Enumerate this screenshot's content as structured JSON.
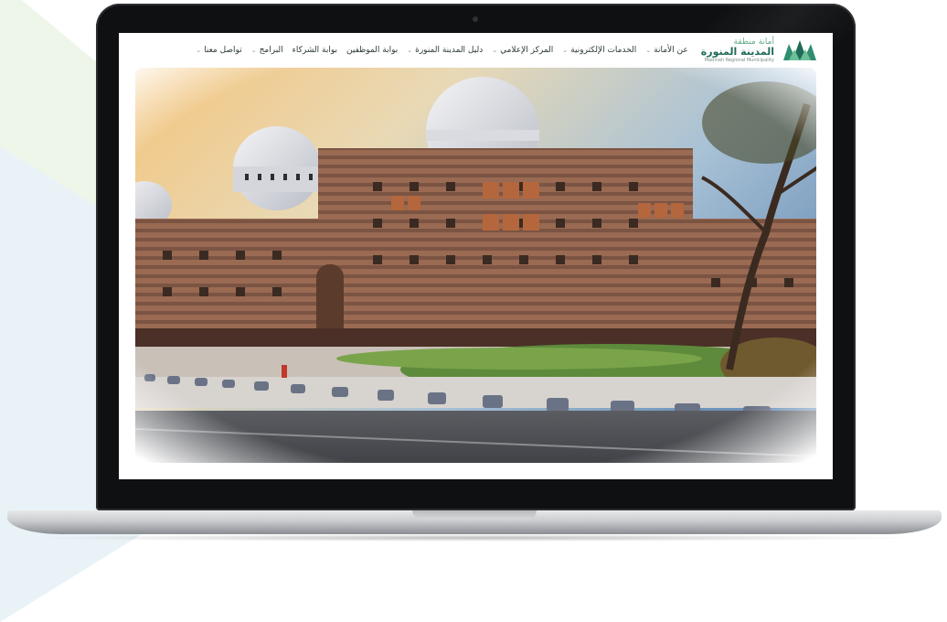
{
  "site": {
    "logo": {
      "arabic_line1": "أمانة منطقة",
      "arabic_line2": "المدينة المنورة",
      "english": "Madinah Regional Municipality"
    },
    "nav": [
      {
        "label": "عن الأمانة",
        "has_dropdown": true
      },
      {
        "label": "الخدمات الإلكترونية",
        "has_dropdown": true
      },
      {
        "label": "المركز الإعلامي",
        "has_dropdown": true
      },
      {
        "label": "دليل المدينة المنورة",
        "has_dropdown": true
      },
      {
        "label": "بوابة الموظفين",
        "has_dropdown": false
      },
      {
        "label": "بوابة الشركاء",
        "has_dropdown": false
      },
      {
        "label": "البرامج",
        "has_dropdown": true
      },
      {
        "label": "تواصل معنا",
        "has_dropdown": true
      }
    ],
    "hero": {
      "image_description": "Municipality building with domes at sunset"
    }
  },
  "colors": {
    "brand_green": "#1d6b58",
    "brand_light_green": "#64a987",
    "laptop_bezel": "#0f1012"
  },
  "icons": {
    "logo": "madinah-logo-icon",
    "dropdown": "chevron-down-icon"
  }
}
